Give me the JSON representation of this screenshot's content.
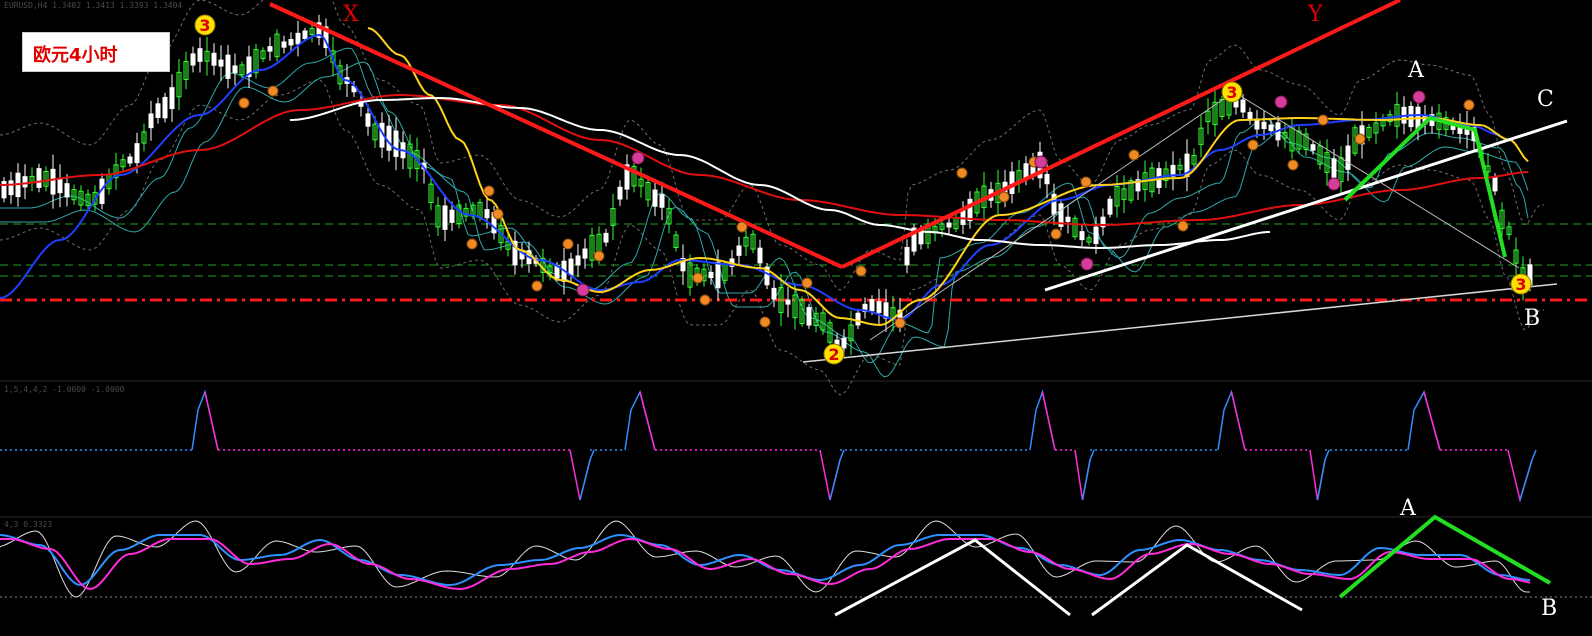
{
  "title": "欧元4小时",
  "chart_header": "EURUSD,H4  1.3402 1.3413 1.3393 1.3404",
  "indicator1_header": "1,5,4,4,2 -1.0000 -1.0000",
  "indicator2_header": "4,3 0.3323",
  "wave_labels": {
    "x": "X",
    "y": "Y",
    "a_price": "A",
    "c_price": "C",
    "b_price": "B",
    "a_osc": "A",
    "b_osc": "B"
  },
  "circle_marks": {
    "three_left": "3",
    "three_mid": "3",
    "three_right": "3",
    "two_bottom": "2"
  },
  "colors": {
    "background": "#000000",
    "bull_candle": "#33ff33",
    "bear_candle": "#ffffff",
    "ma_blue": "#1f3fff",
    "ma_red": "#e01010",
    "ma_yellow": "#ffd21a",
    "ma_white": "#ffffff",
    "bands_teal": "#2fa8a8",
    "bands_gray": "#6e6e6e",
    "red_trend": "#ff1a1a",
    "green_lines": "#22dd22",
    "level_red": "#ff1a1a",
    "level_green": "#1fa01f",
    "osc_blue": "#2e8fff",
    "osc_magenta": "#ff2bd9",
    "osc_white": "#dddddd"
  },
  "chart_data": [
    {
      "type": "candlestick",
      "series": [
        {
          "name": "",
          "role": "price"
        },
        {
          "name": "",
          "role": "moving averages"
        },
        {
          "name": "",
          "role": "bands"
        }
      ],
      "trendlines": [
        {
          "label": "X",
          "kind": "red wave leg"
        },
        {
          "label": "Y",
          "kind": "red wave leg"
        },
        {
          "label": "A-B",
          "kind": "green wave legs"
        },
        {
          "label": "C",
          "kind": "white trendline"
        }
      ],
      "legend": "none",
      "grid": false
    },
    {
      "type": "line",
      "series": [
        {
          "name": "",
          "role": "step indicator"
        }
      ],
      "grid": false
    },
    {
      "type": "line",
      "series": [
        {
          "name": "",
          "role": "oscillator fast"
        },
        {
          "name": "",
          "role": "oscillator signal"
        },
        {
          "name": "",
          "role": "oscillator raw"
        }
      ],
      "grid": false
    }
  ]
}
